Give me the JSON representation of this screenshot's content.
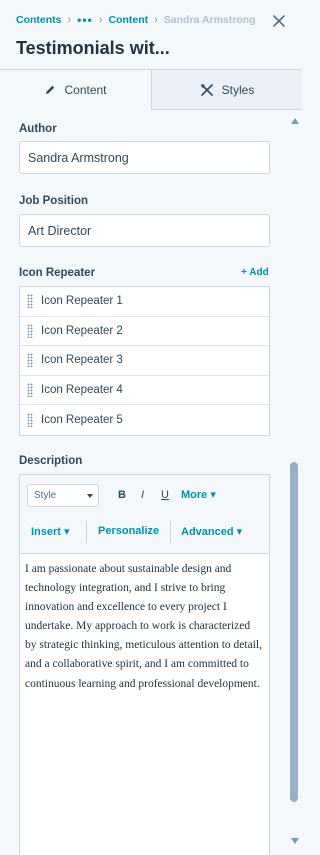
{
  "breadcrumb": {
    "first": "Contents",
    "overflow": "•••",
    "second": "Content",
    "current": "Sandra Armstrong"
  },
  "title": "Testimonials wit...",
  "tabs": [
    {
      "label": "Content",
      "icon": "pencil-icon",
      "active": true
    },
    {
      "label": "Styles",
      "icon": "styles-icon",
      "active": false
    }
  ],
  "author": {
    "label": "Author",
    "value": "Sandra Armstrong"
  },
  "job": {
    "label": "Job Position",
    "value": "Art Director"
  },
  "repeater": {
    "label": "Icon Repeater",
    "add_label": "+ Add",
    "items": [
      "Icon Repeater 1",
      "Icon Repeater 2",
      "Icon Repeater 3",
      "Icon Repeater 4",
      "Icon Repeater 5"
    ]
  },
  "description": {
    "label": "Description",
    "toolbar": {
      "style": "Style",
      "bold": "B",
      "italic": "I",
      "underline": "U",
      "more": "More",
      "insert": "Insert",
      "personalize": "Personalize",
      "advanced": "Advanced"
    },
    "text": "I am passionate about sustainable design and technology integration, and I strive to bring innovation and excellence to every project I undertake. My approach to work is characterized by strategic thinking, meticulous attention to detail, and a collaborative spirit, and I am committed to continuous learning and professional development."
  },
  "colors": {
    "link": "#0091ae",
    "text": "#33475b",
    "border": "#cbd6e2",
    "background": "#f5f8fa"
  }
}
